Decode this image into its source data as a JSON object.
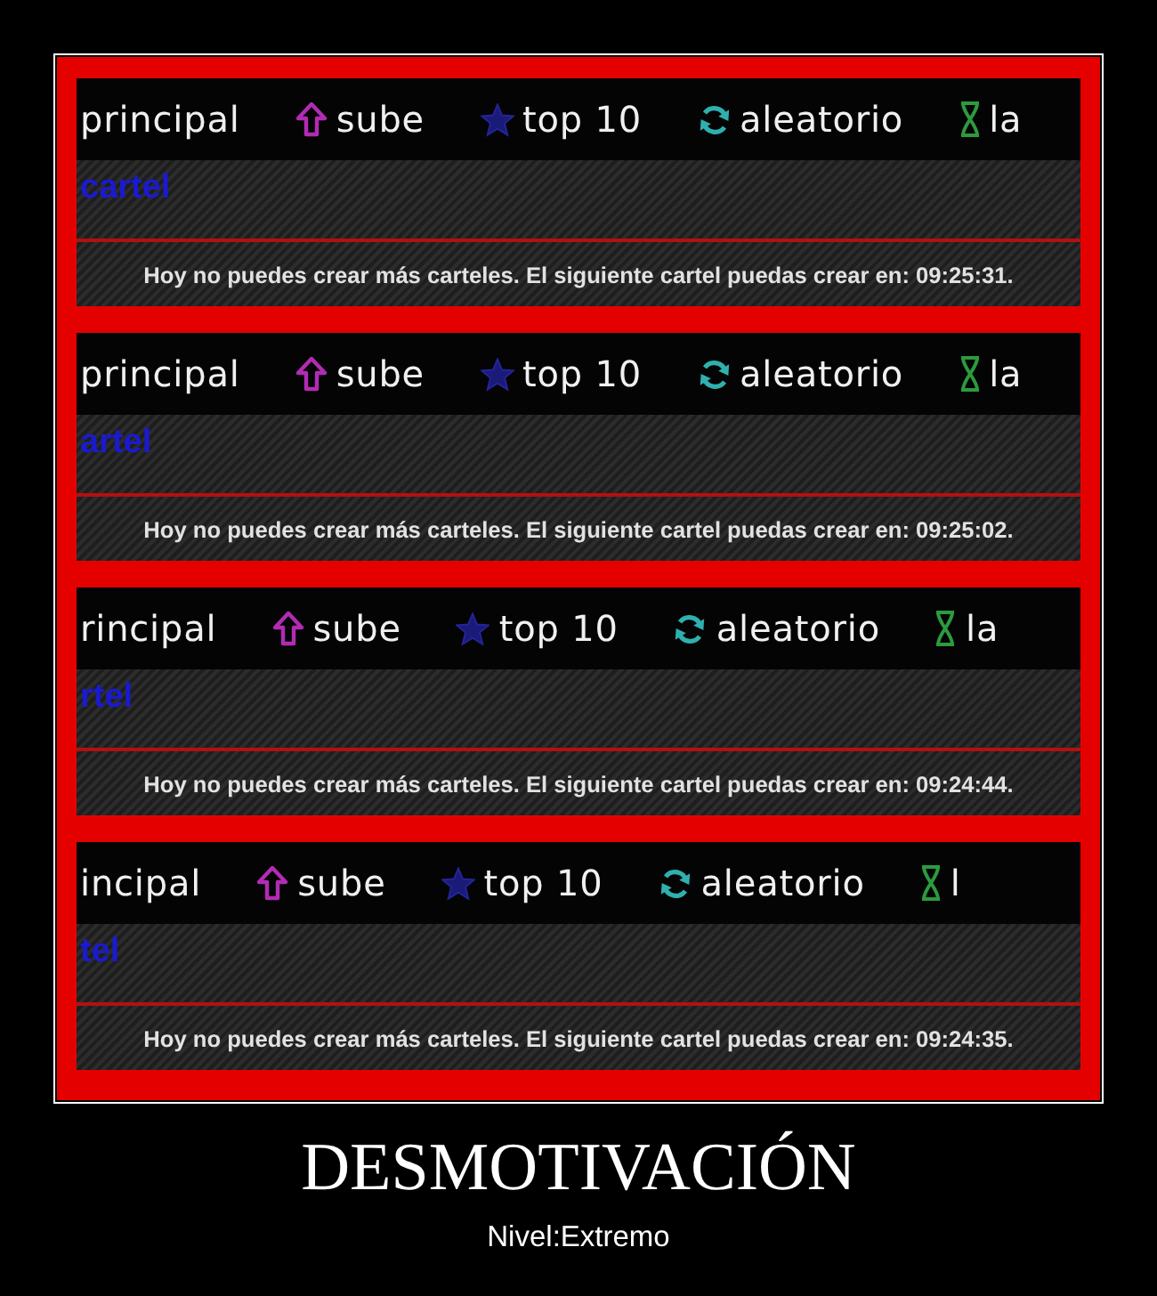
{
  "poster": {
    "panels": [
      {
        "nav": [
          {
            "kind": "plain",
            "label": "principal"
          },
          {
            "kind": "upload",
            "label": "sube"
          },
          {
            "kind": "star",
            "label": "top 10"
          },
          {
            "kind": "refresh",
            "label": "aleatorio"
          },
          {
            "kind": "hourglass",
            "label": "la"
          }
        ],
        "link": "cartel",
        "notice": "Hoy no puedes crear más carteles. El siguiente cartel puedas crear en: 09:25:31."
      },
      {
        "nav": [
          {
            "kind": "plain",
            "label": "principal"
          },
          {
            "kind": "upload",
            "label": "sube"
          },
          {
            "kind": "star",
            "label": "top 10"
          },
          {
            "kind": "refresh",
            "label": "aleatorio"
          },
          {
            "kind": "hourglass",
            "label": "la"
          }
        ],
        "link": "artel",
        "notice": "Hoy no puedes crear más carteles. El siguiente cartel puedas crear en: 09:25:02."
      },
      {
        "nav": [
          {
            "kind": "plain",
            "label": "rincipal"
          },
          {
            "kind": "upload",
            "label": "sube"
          },
          {
            "kind": "star",
            "label": "top 10"
          },
          {
            "kind": "refresh",
            "label": "aleatorio"
          },
          {
            "kind": "hourglass",
            "label": "la"
          }
        ],
        "link": "rtel",
        "notice": "Hoy no puedes crear más carteles. El siguiente cartel puedas crear en: 09:24:44."
      },
      {
        "nav": [
          {
            "kind": "plain",
            "label": "incipal"
          },
          {
            "kind": "upload",
            "label": "sube"
          },
          {
            "kind": "star",
            "label": "top 10"
          },
          {
            "kind": "refresh",
            "label": "aleatorio"
          },
          {
            "kind": "hourglass",
            "label": "l"
          }
        ],
        "link": "tel",
        "notice": "Hoy no puedes crear más carteles. El siguiente cartel puedas crear en: 09:24:35."
      }
    ],
    "title": "DESMOTIVACIÓN",
    "subtitle": "Nivel:Extremo"
  }
}
